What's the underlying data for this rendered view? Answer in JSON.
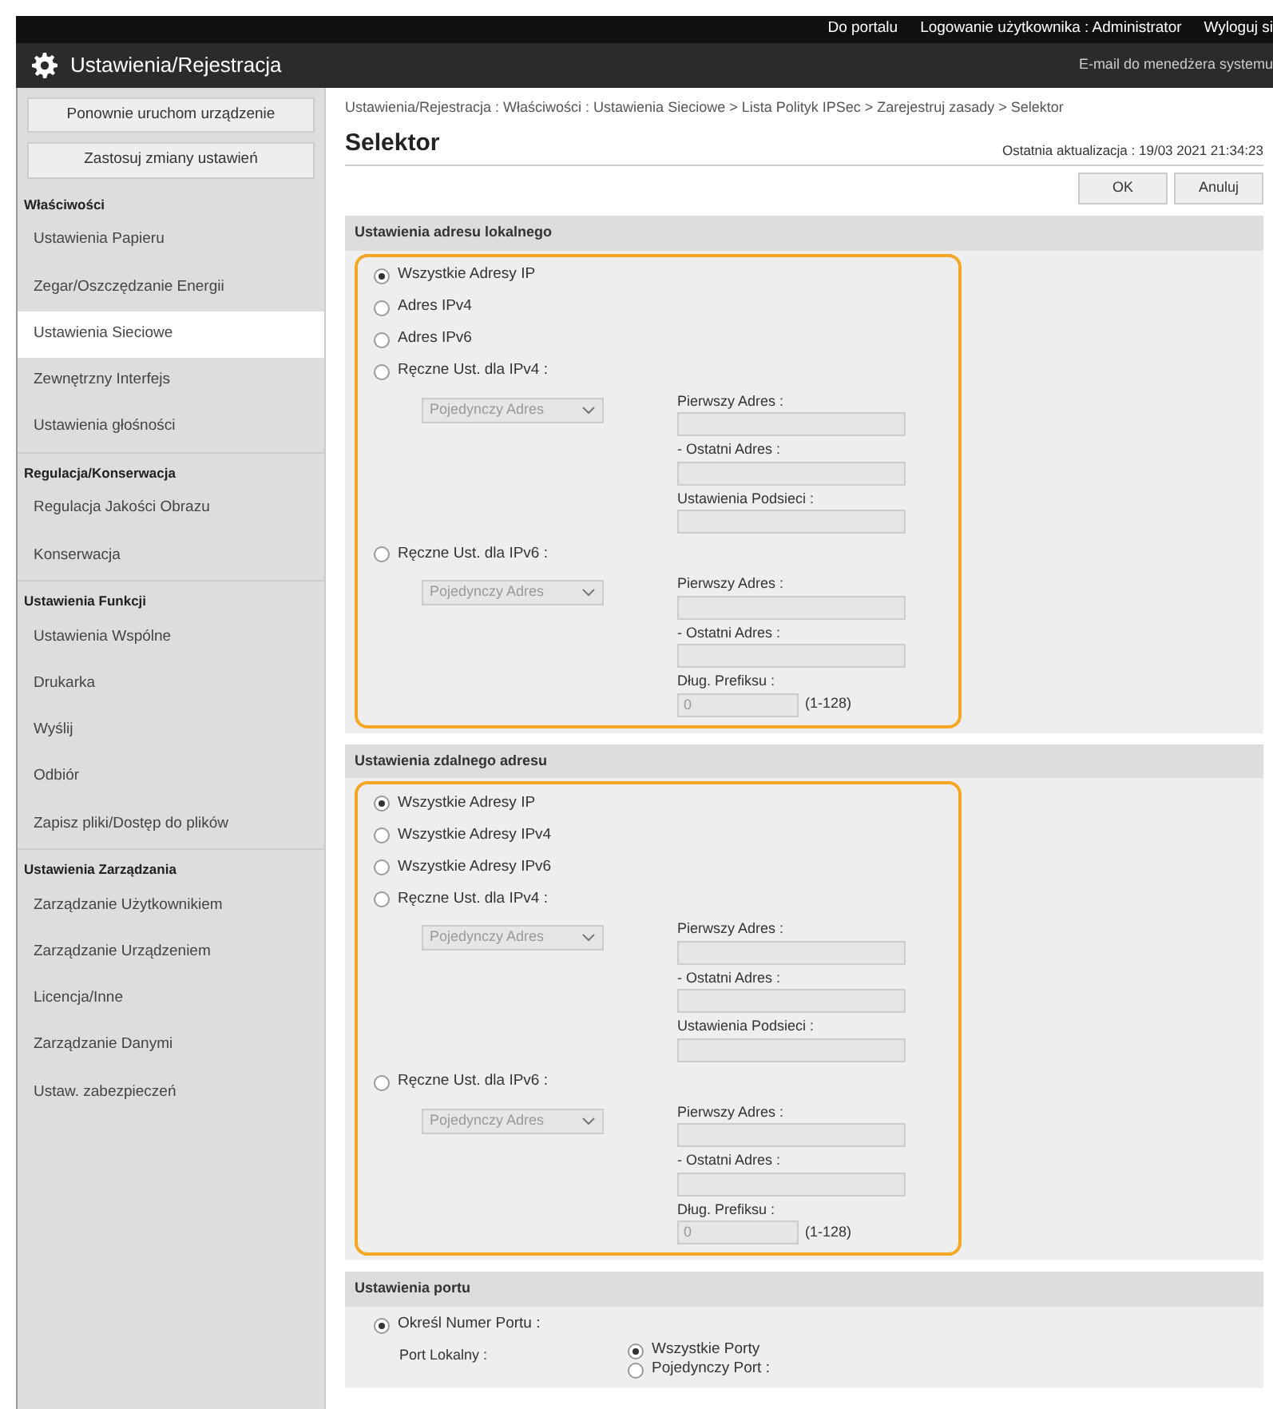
{
  "top_bar": {
    "links": [
      "Do portalu",
      "Logowanie użytkownika : Administrator",
      "Wyloguj si"
    ]
  },
  "header": {
    "title": "Ustawienia/Rejestracja",
    "email_link": "E-mail do menedżera systemu"
  },
  "sidebar": {
    "buttons": [
      "Ponownie uruchom urządzenie",
      "Zastosuj zmiany ustawień"
    ],
    "groups": [
      {
        "title": "Właściwości",
        "items": [
          {
            "label": "Ustawienia Papieru",
            "selected": false
          },
          {
            "label": "Zegar/Oszczędzanie Energii",
            "selected": false
          },
          {
            "label": "Ustawienia Sieciowe",
            "selected": true
          },
          {
            "label": "Zewnętrzny Interfejs",
            "selected": false
          },
          {
            "label": "Ustawienia głośności",
            "selected": false
          }
        ]
      },
      {
        "title": "Regulacja/Konserwacja",
        "items": [
          {
            "label": "Regulacja Jakości Obrazu",
            "selected": false
          },
          {
            "label": "Konserwacja",
            "selected": false
          }
        ]
      },
      {
        "title": "Ustawienia Funkcji",
        "items": [
          {
            "label": "Ustawienia Wspólne",
            "selected": false
          },
          {
            "label": "Drukarka",
            "selected": false
          },
          {
            "label": "Wyślij",
            "selected": false
          },
          {
            "label": "Odbiór",
            "selected": false
          },
          {
            "label": "Zapisz pliki/Dostęp do plików",
            "selected": false
          }
        ]
      },
      {
        "title": "Ustawienia Zarządzania",
        "items": [
          {
            "label": "Zarządzanie Użytkownikiem",
            "selected": false
          },
          {
            "label": "Zarządzanie Urządzeniem",
            "selected": false
          },
          {
            "label": "Licencja/Inne",
            "selected": false
          },
          {
            "label": "Zarządzanie Danymi",
            "selected": false
          },
          {
            "label": "Ustaw. zabezpieczeń",
            "selected": false
          }
        ]
      }
    ]
  },
  "main": {
    "breadcrumb": "Ustawienia/Rejestracja : Właściwości : Ustawienia Sieciowe > Lista Polityk IPSec > Zarejestruj zasady > Selektor",
    "title": "Selektor",
    "last_update": "Ostatnia aktualizacja : 19/03 2021 21:34:23",
    "buttons": [
      "OK",
      "Anuluj"
    ],
    "sections": [
      {
        "title": "Ustawienia adresu lokalnego",
        "highlighted": true,
        "options": [
          {
            "label": "Wszystkie Adresy IP",
            "selected": true
          },
          {
            "label": "Adres IPv4",
            "selected": false
          },
          {
            "label": "Adres IPv6",
            "selected": false
          },
          {
            "label": "Ręczne Ust. dla IPv4 :",
            "selected": false,
            "detail": {
              "select": "Pojedynczy Adres",
              "fields": [
                {
                  "label": "Pierwszy Adres :"
                },
                {
                  "label": "- Ostatni Adres :"
                },
                {
                  "label": "Ustawienia Podsieci :"
                }
              ]
            }
          },
          {
            "label": "Ręczne Ust. dla IPv6 :",
            "selected": false,
            "detail": {
              "select": "Pojedynczy Adres",
              "fields": [
                {
                  "label": "Pierwszy Adres :"
                },
                {
                  "label": "- Ostatni Adres :"
                },
                {
                  "label": "Dług. Prefiksu :",
                  "value": "0",
                  "hint": "(1-128)"
                }
              ]
            }
          }
        ]
      },
      {
        "title": "Ustawienia zdalnego adresu",
        "highlighted": true,
        "options": [
          {
            "label": "Wszystkie Adresy IP",
            "selected": true
          },
          {
            "label": "Wszystkie Adresy IPv4",
            "selected": false
          },
          {
            "label": "Wszystkie Adresy IPv6",
            "selected": false
          },
          {
            "label": "Ręczne Ust. dla IPv4 :",
            "selected": false,
            "detail": {
              "select": "Pojedynczy Adres",
              "fields": [
                {
                  "label": "Pierwszy Adres :"
                },
                {
                  "label": "- Ostatni Adres :"
                },
                {
                  "label": "Ustawienia Podsieci :"
                }
              ]
            }
          },
          {
            "label": "Ręczne Ust. dla IPv6 :",
            "selected": false,
            "detail": {
              "select": "Pojedynczy Adres",
              "fields": [
                {
                  "label": "Pierwszy Adres :"
                },
                {
                  "label": "- Ostatni Adres :"
                },
                {
                  "label": "Dług. Prefiksu :",
                  "value": "0",
                  "hint": "(1-128)"
                }
              ]
            }
          }
        ]
      },
      {
        "title": "Ustawienia portu",
        "highlighted": false,
        "options": [
          {
            "label": "Określ Numer Portu :",
            "selected": true,
            "ports": {
              "label": "Port Lokalny :",
              "choices": [
                {
                  "label": "Wszystkie Porty",
                  "selected": true
                },
                {
                  "label": "Pojedynczy Port :",
                  "selected": false
                }
              ]
            }
          }
        ]
      }
    ]
  }
}
